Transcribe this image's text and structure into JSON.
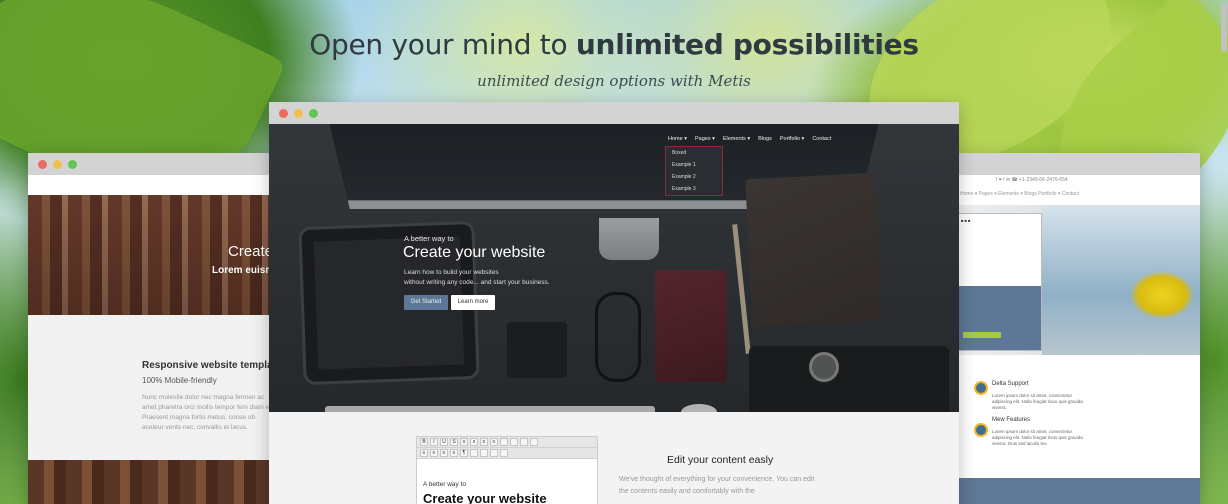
{
  "headline": {
    "prefix": "Open your mind to",
    "bold": "unlimited possibilities",
    "subtitle": "unlimited design options with Metis"
  },
  "left_window": {
    "hero_title": "Create",
    "hero_subtitle": "Lorem euism",
    "section_heading": "Responsive website templates.",
    "section_subheading": "100% Mobile-friendly",
    "paragraph": "Nunc molestie dolor nec magna fermen ac amet pharetra orci mollis tempor fem diam elit. Praesent magna fortis metus, conse ob aceteur vents nec, convallis et lacus."
  },
  "main_window": {
    "nav": [
      "Home ▾",
      "Pages ▾",
      "Elements ▾",
      "Blogs",
      "Portfolio ▾",
      "Contact"
    ],
    "dropdown": [
      "Boxed",
      "Example 1",
      "Example 2",
      "Example 3"
    ],
    "kicker": "A better way to",
    "title": "Create your website",
    "desc_line1": "Learn how to build your websites",
    "desc_line2": "without writing any code... and start your business.",
    "primary_button": "Get Started",
    "secondary_button": "Learn more",
    "toolbar_row1": [
      "B",
      "I",
      "U",
      "S",
      "x",
      "x",
      "≡",
      "≡",
      "",
      "",
      "",
      "",
      ""
    ],
    "toolbar_row2": [
      "≡",
      "≡",
      "≡",
      "≡",
      "¶",
      "",
      "",
      "",
      ""
    ],
    "editor_kicker": "A better way to",
    "editor_title": "Create your website",
    "edit_heading": "Edit your content easly",
    "edit_paragraph": "We've thought of everything for your convenience. You can edit the contents easily and comfortably with the"
  },
  "right_window": {
    "topbar": "f  ♥  t  ✉  ☎ +1-2345-66-2476-654",
    "nav": "Home ▾   Pages ▾   Elements ▾   Blogs   Portfolio ▾   Contact",
    "feature1_title": "Delta Support",
    "feature1_text": "Lorem ipsum dolor sit amet, consectetur adipiscing elit. Nulla feugiat risus quis gravida viverra.",
    "feature2_title": "Mew Features",
    "feature2_text": "Lorem ipsum dolor sit amet, consectetur adipiscing elit. Nulla feugiat risus quis gravida viverra. Duis sed iaculis leo."
  },
  "colors": {
    "accent": "#5d7896",
    "dropdown_border": "#8a2d33",
    "window_bar": "#d3d3d3"
  }
}
